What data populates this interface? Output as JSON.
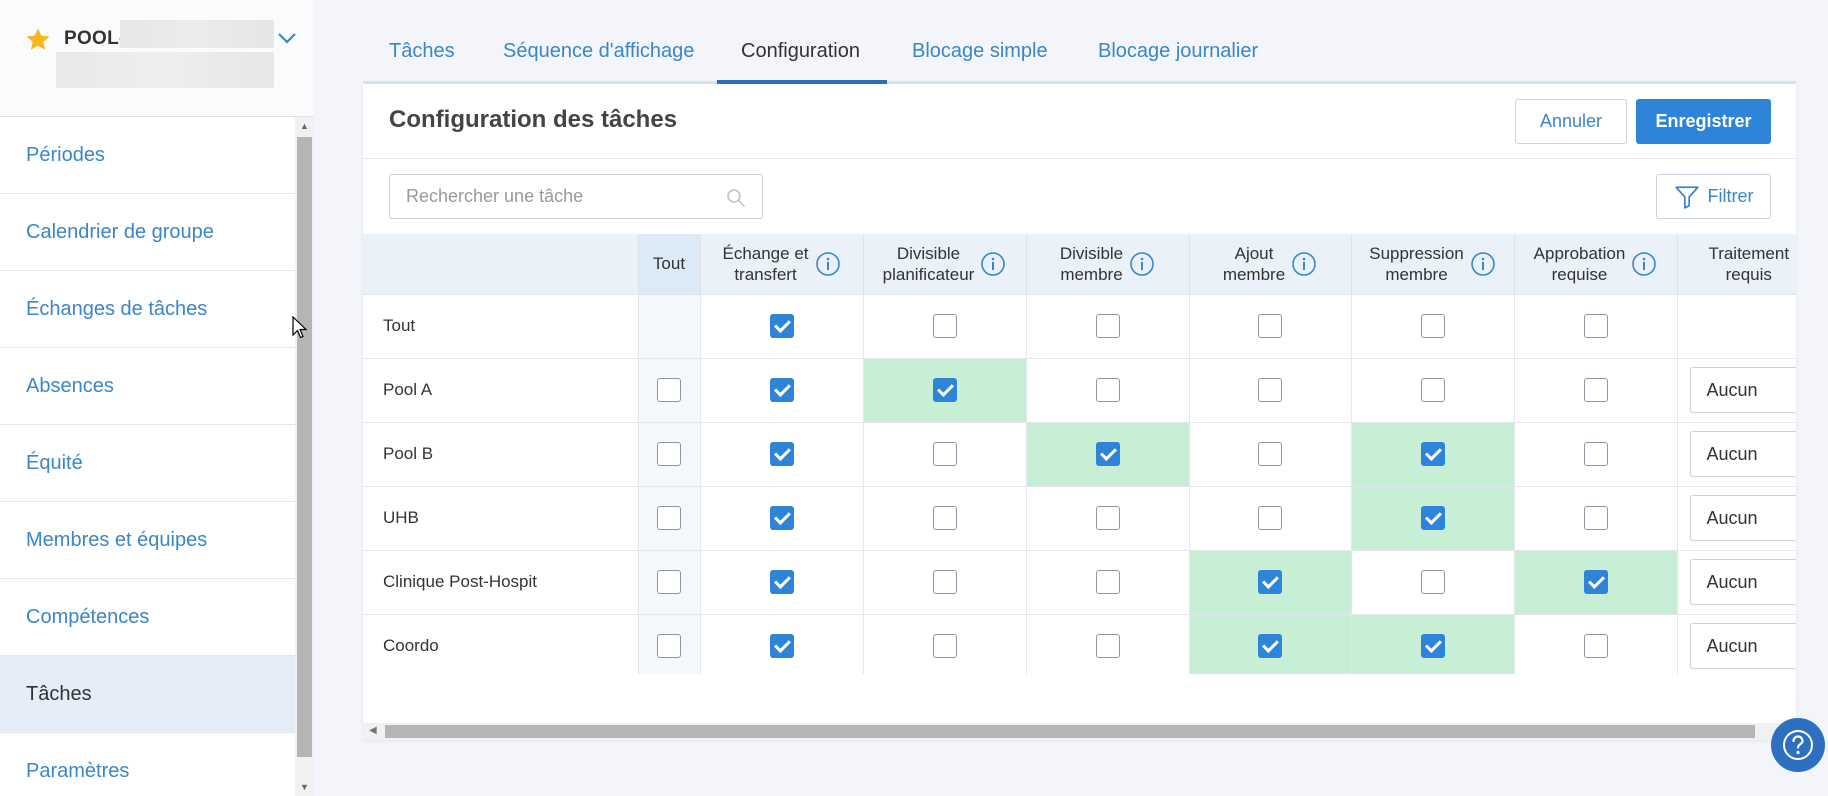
{
  "pool": {
    "name": "POOL-"
  },
  "nav": {
    "items": [
      {
        "label": "Périodes"
      },
      {
        "label": "Calendrier de groupe"
      },
      {
        "label": "Échanges de tâches"
      },
      {
        "label": "Absences"
      },
      {
        "label": "Équité"
      },
      {
        "label": "Membres et équipes"
      },
      {
        "label": "Compétences"
      },
      {
        "label": "Tâches"
      },
      {
        "label": "Paramètres"
      }
    ],
    "active": "Tâches"
  },
  "tabs": [
    {
      "label": "Tâches"
    },
    {
      "label": "Séquence d'affichage"
    },
    {
      "label": "Configuration"
    },
    {
      "label": "Blocage simple"
    },
    {
      "label": "Blocage journalier"
    }
  ],
  "active_tab": "Configuration",
  "card": {
    "title": "Configuration des tâches",
    "cancel_label": "Annuler",
    "save_label": "Enregistrer",
    "search_placeholder": "Rechercher une tâche",
    "filter_label": "Filtrer"
  },
  "table": {
    "columns": [
      {
        "label": "Tout"
      },
      {
        "line1": "Échange et",
        "line2": "transfert"
      },
      {
        "line1": "Divisible",
        "line2": "planificateur"
      },
      {
        "line1": "Divisible",
        "line2": "membre"
      },
      {
        "line1": "Ajout",
        "line2": "membre"
      },
      {
        "line1": "Suppression",
        "line2": "membre"
      },
      {
        "line1": "Approbation",
        "line2": "requise"
      },
      {
        "line1": "Traitement",
        "line2": "requis"
      }
    ],
    "tout_row": {
      "label": "Tout",
      "checks": [
        true,
        false,
        false,
        false,
        false,
        false
      ]
    },
    "rows": [
      {
        "label": "Pool A",
        "tout": false,
        "checks": [
          true,
          true,
          false,
          false,
          false,
          false
        ],
        "highlight": [
          false,
          true,
          false,
          false,
          false,
          false
        ],
        "traitement": "Aucun"
      },
      {
        "label": "Pool B",
        "tout": false,
        "checks": [
          true,
          false,
          true,
          false,
          true,
          false
        ],
        "highlight": [
          false,
          false,
          true,
          false,
          true,
          false
        ],
        "traitement": "Aucun"
      },
      {
        "label": "UHB",
        "tout": false,
        "checks": [
          true,
          false,
          false,
          false,
          true,
          false
        ],
        "highlight": [
          false,
          false,
          false,
          false,
          true,
          false
        ],
        "traitement": "Aucun"
      },
      {
        "label": "Clinique Post-Hospit",
        "tout": false,
        "checks": [
          true,
          false,
          false,
          true,
          false,
          true
        ],
        "highlight": [
          false,
          false,
          false,
          true,
          false,
          true
        ],
        "traitement": "Aucun"
      },
      {
        "label": "Coordo",
        "tout": false,
        "checks": [
          true,
          false,
          false,
          true,
          true,
          false
        ],
        "highlight": [
          false,
          false,
          false,
          true,
          true,
          false
        ],
        "traitement": "Aucun"
      }
    ]
  },
  "colors": {
    "accent": "#2d84d8",
    "link": "#3a86c8",
    "highlight": "#c7efd5",
    "star": "#f5b820"
  }
}
